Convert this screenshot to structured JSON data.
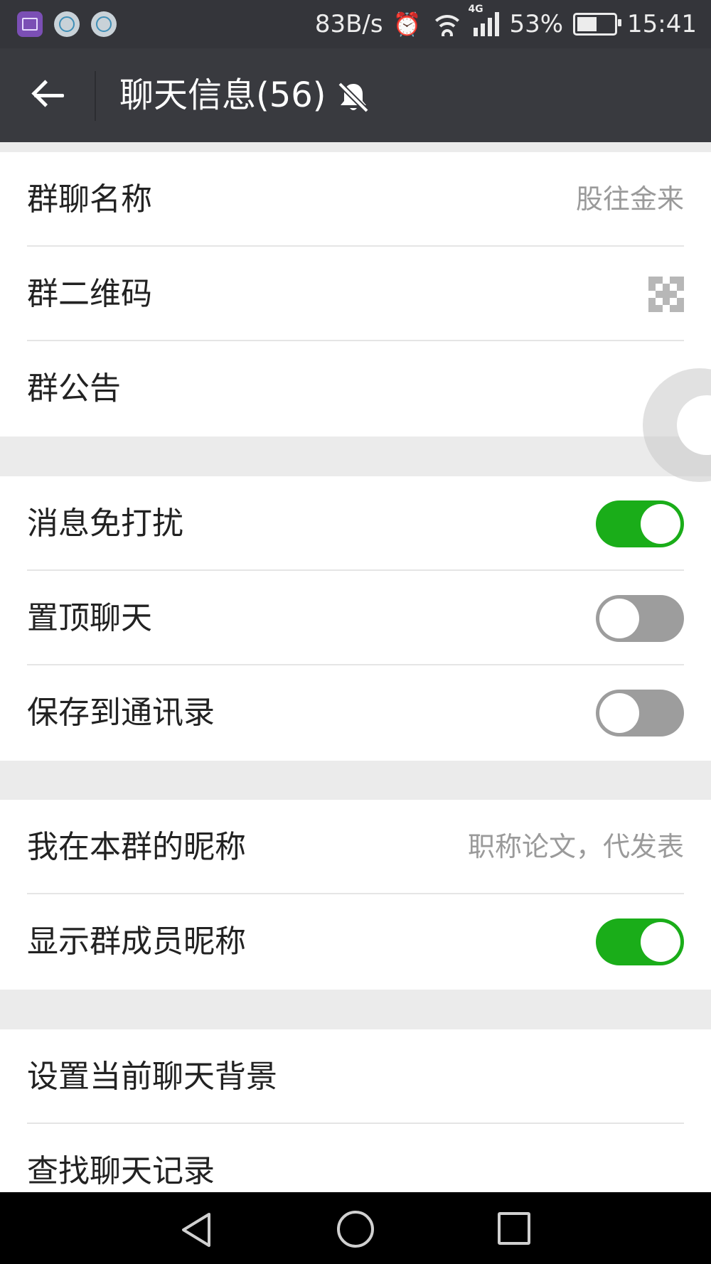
{
  "status_bar": {
    "speed": "83B/s",
    "network_type": "4G",
    "battery_text": "53%",
    "battery_level": 0.53,
    "time": "15:41"
  },
  "header": {
    "title": "聊天信息(56)",
    "back_icon": "back-arrow-icon",
    "mute_icon": "bell-off-icon"
  },
  "groups": [
    {
      "rows": [
        {
          "label": "群聊名称",
          "value": "股往金来"
        },
        {
          "label": "群二维码",
          "icon": "qr-code-icon"
        },
        {
          "label": "群公告"
        }
      ]
    },
    {
      "rows": [
        {
          "label": "消息免打扰",
          "toggle": true
        },
        {
          "label": "置顶聊天",
          "toggle": false
        },
        {
          "label": "保存到通讯录",
          "toggle": false
        }
      ]
    },
    {
      "rows": [
        {
          "label": "我在本群的昵称",
          "value": "职称论文，代发表"
        },
        {
          "label": "显示群成员昵称",
          "toggle": true
        }
      ]
    },
    {
      "rows": [
        {
          "label": "设置当前聊天背景"
        },
        {
          "label": "查找聊天记录"
        }
      ]
    }
  ],
  "colors": {
    "toggle_on": "#1aad19",
    "toggle_off": "#9d9d9d",
    "header_bg": "#393a3f",
    "statusbar_bg": "#34353a"
  }
}
